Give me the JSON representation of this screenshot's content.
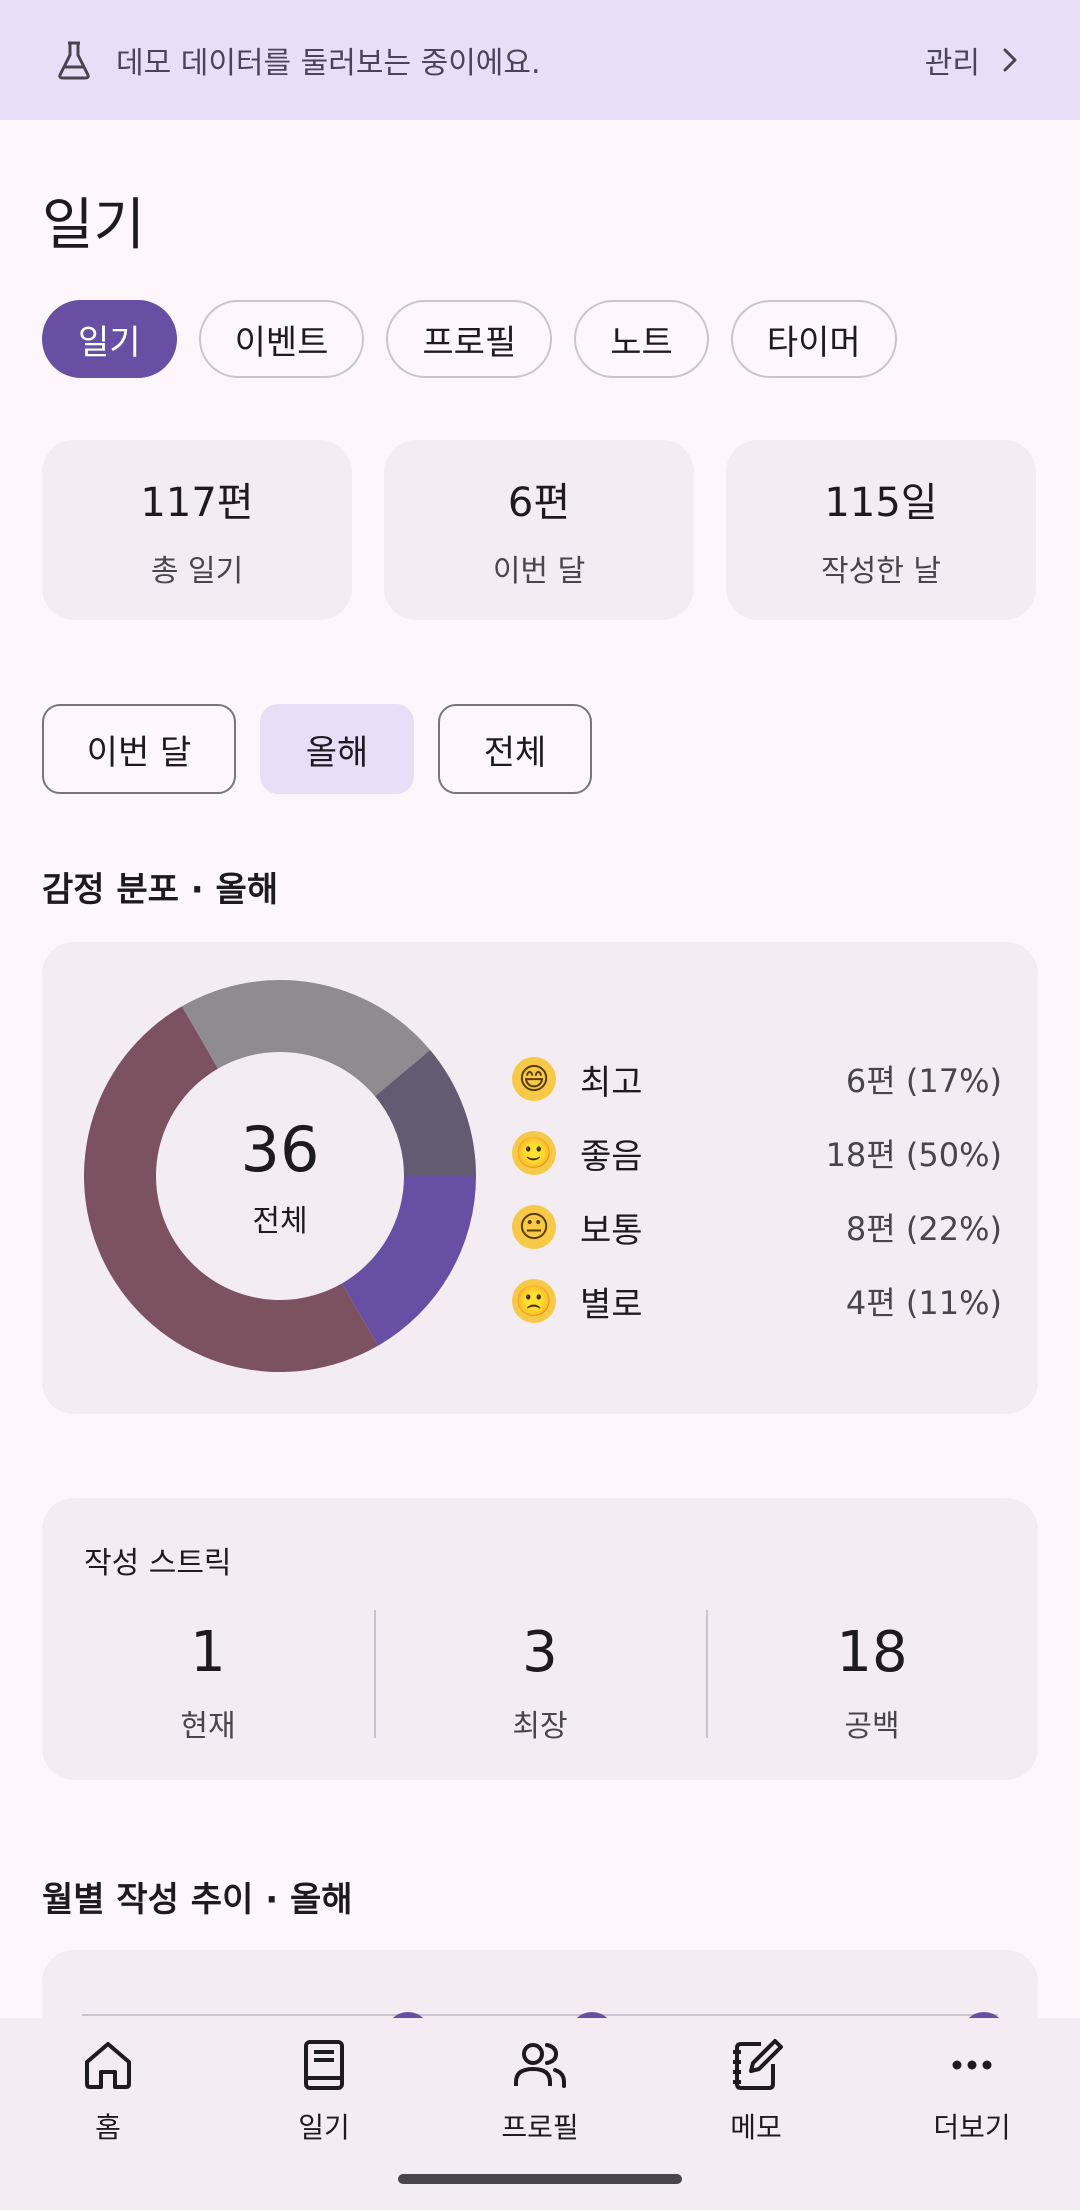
{
  "banner": {
    "text": "데모 데이터를 둘러보는 중이에요.",
    "manage_label": "관리"
  },
  "page_title": "일기",
  "tabs": [
    {
      "label": "일기",
      "active": true
    },
    {
      "label": "이벤트",
      "active": false
    },
    {
      "label": "프로필",
      "active": false
    },
    {
      "label": "노트",
      "active": false
    },
    {
      "label": "타이머",
      "active": false
    }
  ],
  "stats": [
    {
      "value": "117편",
      "label": "총 일기"
    },
    {
      "value": "6편",
      "label": "이번 달"
    },
    {
      "value": "115일",
      "label": "작성한 날"
    }
  ],
  "periods": [
    {
      "label": "이번 달",
      "selected": false
    },
    {
      "label": "올해",
      "selected": true
    },
    {
      "label": "전체",
      "selected": false
    }
  ],
  "emotion_section_title": "감정 분포 · 올해",
  "chart_data": {
    "type": "pie",
    "total": 36,
    "total_value": "36",
    "total_label": "전체",
    "categories": [
      "최고",
      "좋음",
      "보통",
      "별로"
    ],
    "values": [
      6,
      18,
      8,
      4
    ],
    "colors": [
      "#6750a4",
      "#7d5260",
      "#8e8c91",
      "#625b71"
    ],
    "legend_counts": [
      "6편 (17%)",
      "18편 (50%)",
      "8편 (22%)",
      "4편 (11%)"
    ],
    "legend_emojis": [
      "😄",
      "🙂",
      "😐",
      "🙁"
    ]
  },
  "streak": {
    "title": "작성 스트릭",
    "items": [
      {
        "value": "1",
        "label": "현재"
      },
      {
        "value": "3",
        "label": "최장"
      },
      {
        "value": "18",
        "label": "공백"
      }
    ]
  },
  "monthly_section_title": "월별 작성 추이 · 올해",
  "bottom_nav": [
    {
      "label": "홈",
      "icon": "home-icon"
    },
    {
      "label": "일기",
      "icon": "book-icon"
    },
    {
      "label": "프로필",
      "icon": "people-icon"
    },
    {
      "label": "메모",
      "icon": "note-edit-icon"
    },
    {
      "label": "더보기",
      "icon": "more-horizontal-icon"
    }
  ]
}
